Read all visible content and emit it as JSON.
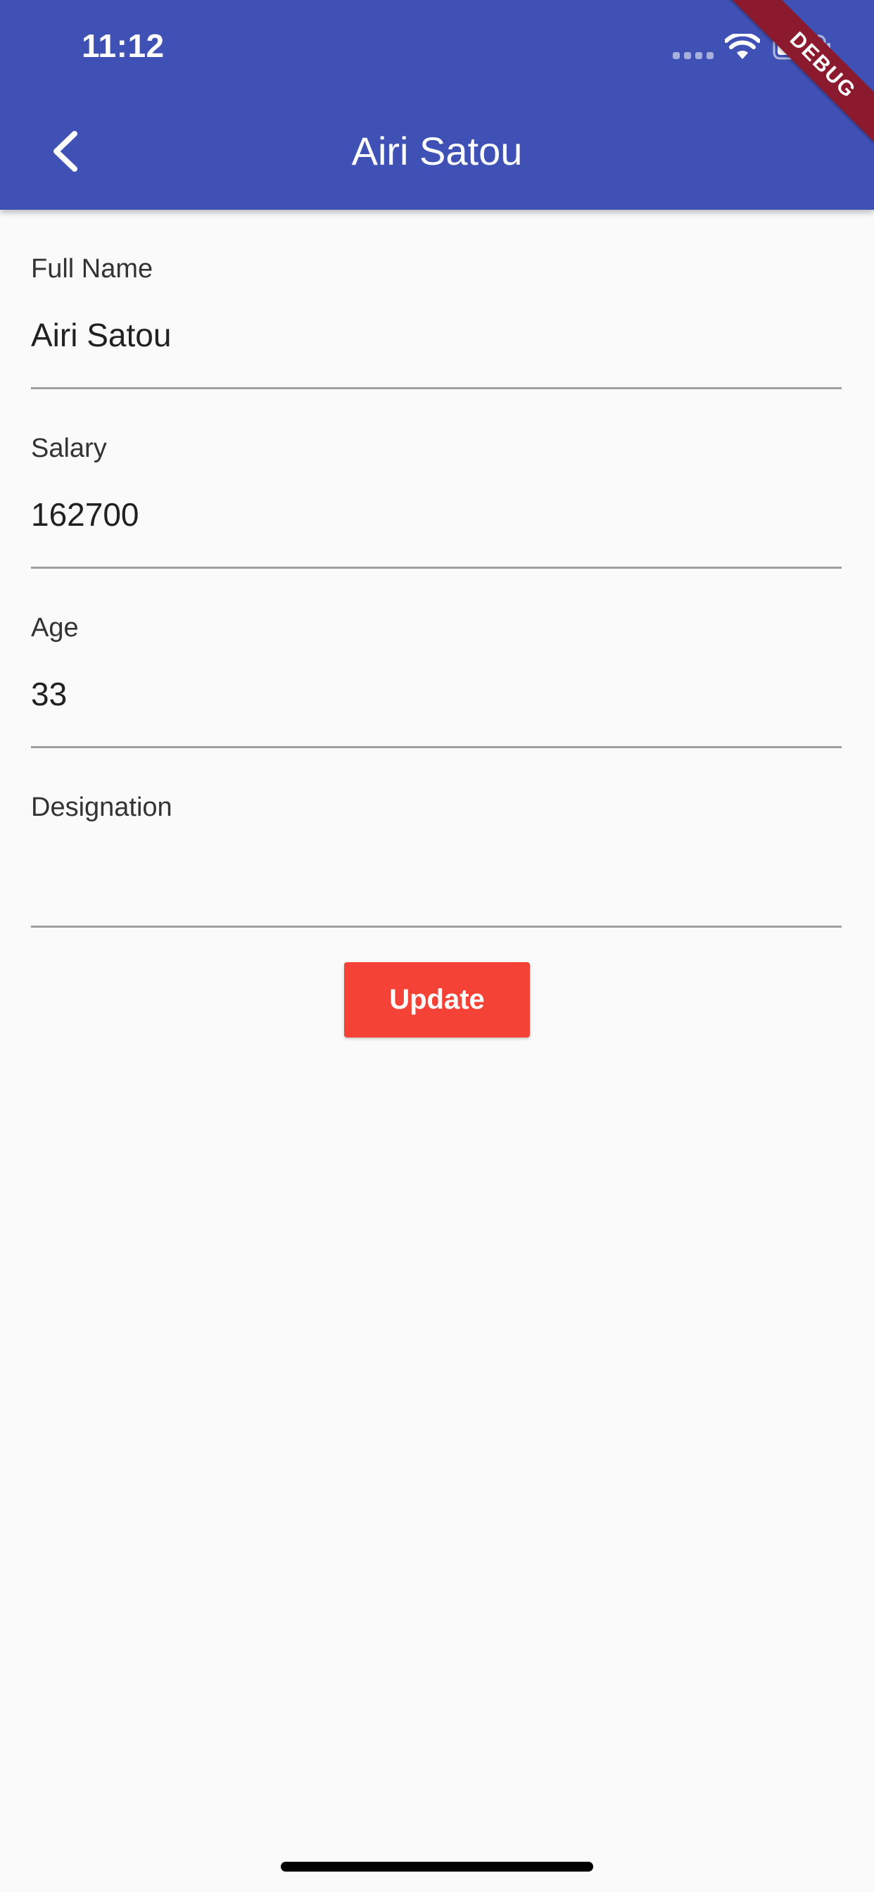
{
  "status_bar": {
    "time": "11:12"
  },
  "app_bar": {
    "title": "Airi Satou",
    "background_color": "#3f51b5",
    "back_icon": "chevron-left-icon"
  },
  "debug_banner": {
    "label": "DEBUG",
    "color": "#8b1a2f"
  },
  "form": {
    "fields": [
      {
        "label": "Full Name",
        "value": "Airi Satou"
      },
      {
        "label": "Salary",
        "value": "162700"
      },
      {
        "label": "Age",
        "value": "33"
      },
      {
        "label": "Designation",
        "value": ""
      }
    ],
    "update_button": {
      "label": "Update",
      "color": "#f44336"
    }
  }
}
